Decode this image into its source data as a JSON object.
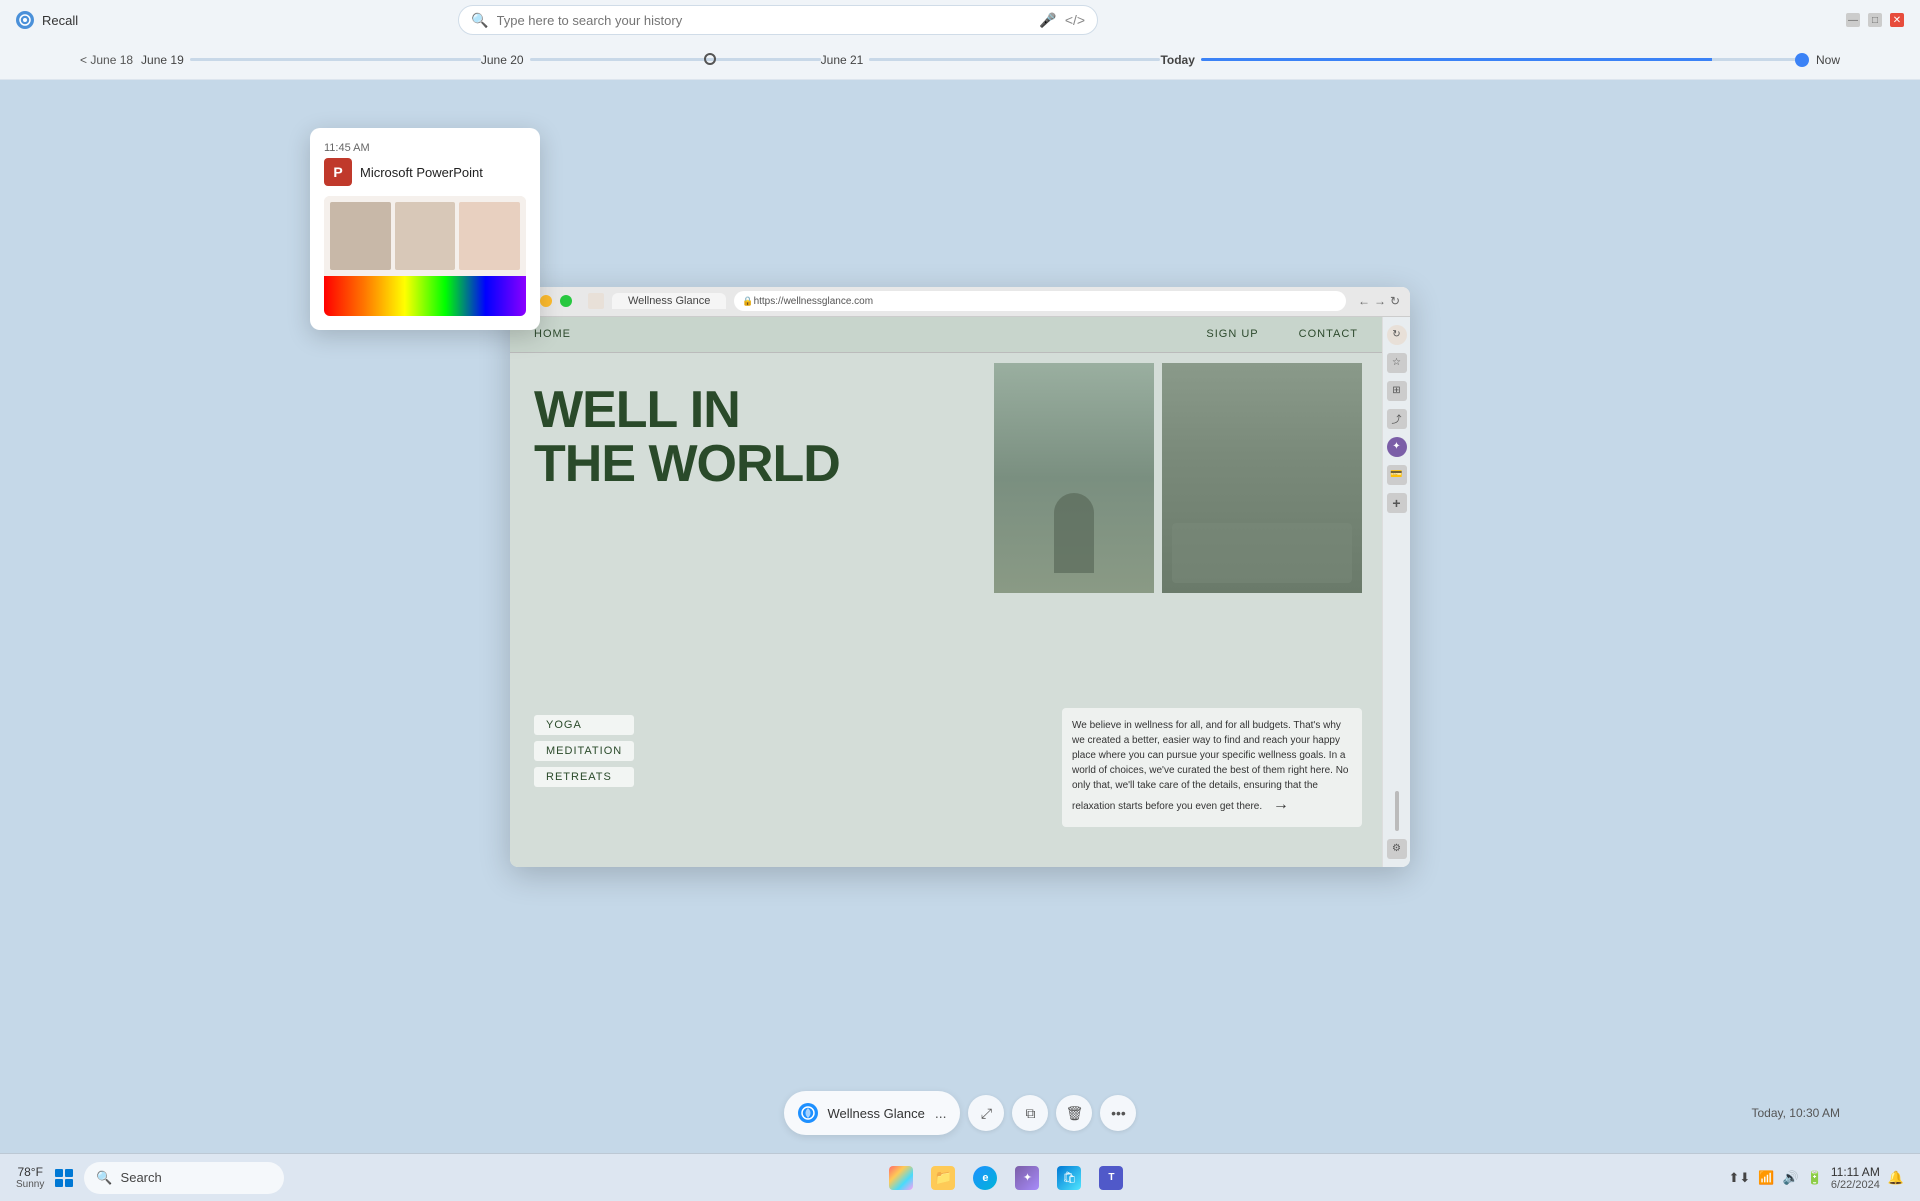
{
  "app": {
    "title": "Recall",
    "icon": "recall-icon"
  },
  "titlebar": {
    "title": "Recall",
    "search_placeholder": "Type here to search your history",
    "min_btn": "—",
    "max_btn": "□",
    "close_btn": "✕"
  },
  "timeline": {
    "back_label": "< June 18",
    "dates": [
      "June 18",
      "June 19",
      "June 20",
      "June 21",
      "Today",
      "Now"
    ],
    "current": "Today"
  },
  "tooltip": {
    "time": "11:45 AM",
    "app_name": "Microsoft PowerPoint"
  },
  "browser": {
    "url": "https://wellnessglance.com",
    "tab_title": "Wellness Glance"
  },
  "wellness": {
    "nav_home": "HOME",
    "nav_signup": "SIGN UP",
    "nav_contact": "CONTACT",
    "headline_line1": "WELL IN",
    "headline_line2": "THE WORLD",
    "menu_items": [
      "YOGA",
      "MEDITATION",
      "RETREATS"
    ],
    "body_text": "We believe in wellness for all, and for all budgets. That's why we created a better, easier way to find and reach your happy place where you can pursue your specific wellness goals. In a world of choices, we've curated the best of them right here. No only that, we'll take care of the details, ensuring that the relaxation starts before you even get there."
  },
  "bottom_toolbar": {
    "site_name": "Wellness Glance",
    "dots_label": "...",
    "timestamp": "Today, 10:30 AM",
    "expand_label": "⤢",
    "copy_label": "⧉",
    "delete_label": "🗑",
    "more_label": "•••"
  },
  "taskbar": {
    "search_text": "Search",
    "time": "11:11 AM",
    "date": "6/22/2024",
    "weather_temp": "78°F",
    "weather_cond": "Sunny"
  }
}
